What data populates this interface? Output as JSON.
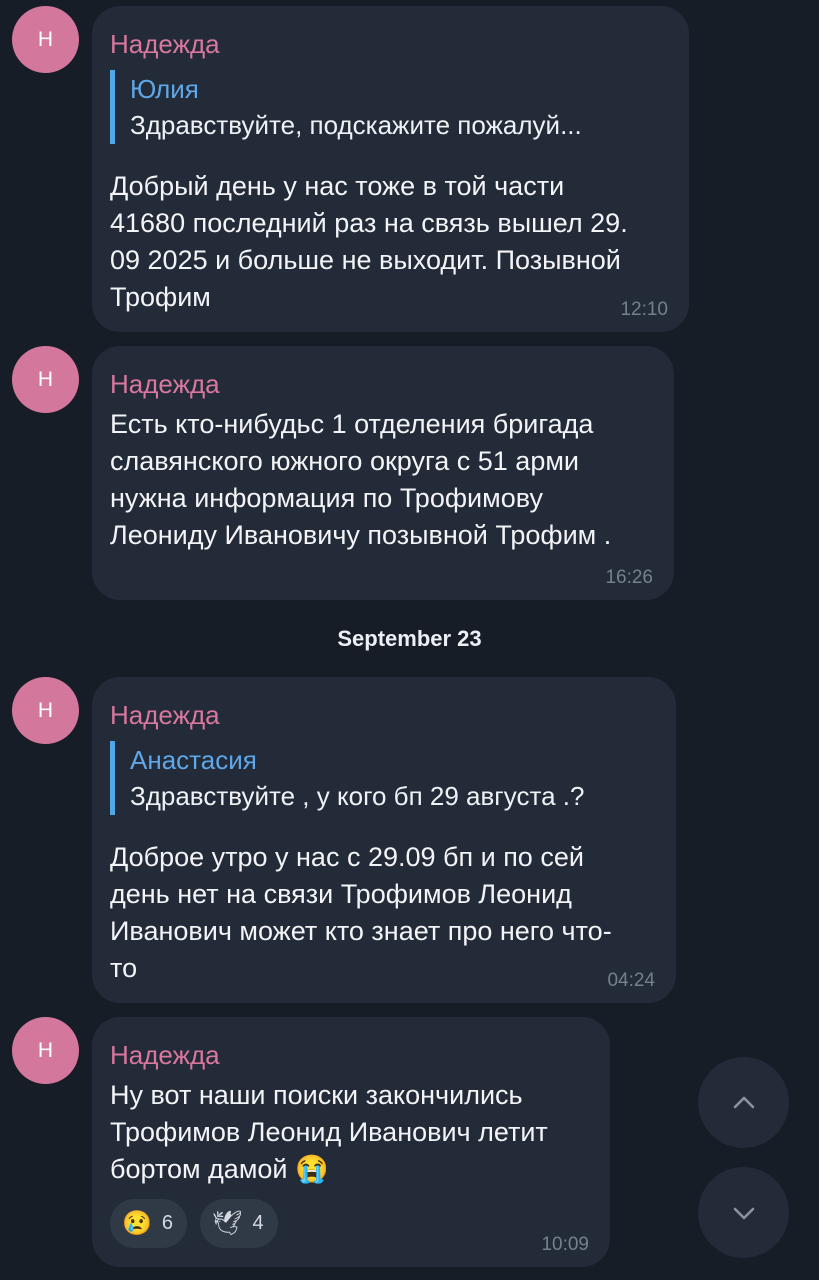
{
  "date_separator": "September 23",
  "messages": [
    {
      "avatar_letter": "Н",
      "sender": "Надежда",
      "reply": {
        "author": "Юлия",
        "text": "Здравствуйте, подскажите пожалуй..."
      },
      "text_lines": [
        "Добрый день у нас тоже в той части",
        "41680 последний раз на связь вышел 29.",
        "09 2025 и больше не выходит. Позывной",
        "Трофим"
      ],
      "time": "12:10"
    },
    {
      "avatar_letter": "Н",
      "sender": "Надежда",
      "text_lines": [
        "Есть кто-нибудьс  1 отделения бригада",
        "славянского южного округа   с 51 арми",
        "нужна информация по Трофимову",
        "Леониду Ивановичу позывной Трофим ."
      ],
      "time": "16:26"
    },
    {
      "avatar_letter": "Н",
      "sender": "Надежда",
      "reply": {
        "author": "Анастасия",
        "text": "Здравствуйте , у кого бп 29 августа .?"
      },
      "text_lines": [
        "Доброе утро у нас с 29.09 бп и по сей",
        "день нет на связи Трофимов  Леонид",
        "Иванович может кто знает про него что-",
        "то"
      ],
      "time": "04:24"
    },
    {
      "avatar_letter": "Н",
      "sender": "Надежда",
      "text_lines": [
        "Ну вот наши поиски закончились",
        "Трофимов Леонид Иванович летит",
        "бортом дамой"
      ],
      "text_emoji": "😭",
      "reactions": [
        {
          "emoji": "😢",
          "count": "6"
        },
        {
          "emoji": "🕊",
          "count": "4"
        }
      ],
      "time": "10:09"
    }
  ],
  "colors": {
    "background": "#161d27",
    "bubble": "#222b37",
    "sender_name": "#d9779e",
    "reply_accent": "#52a7e6",
    "avatar": "#d4779c"
  },
  "icons": {
    "scroll_up": "chevron-up-icon",
    "scroll_down": "chevron-down-icon"
  }
}
